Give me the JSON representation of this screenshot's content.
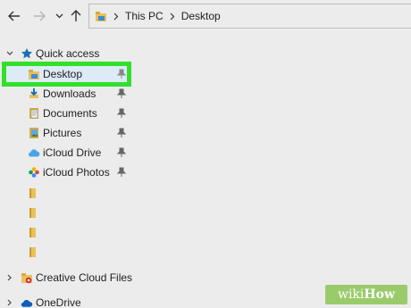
{
  "address": {
    "crumbs": [
      "This PC",
      "Desktop"
    ]
  },
  "nav": {
    "quick_access": "Quick access",
    "items": [
      {
        "label": "Desktop",
        "icon": "desktop-folder-icon",
        "pinned": true,
        "selected": true
      },
      {
        "label": "Downloads",
        "icon": "downloads-folder-icon",
        "pinned": true
      },
      {
        "label": "Documents",
        "icon": "documents-folder-icon",
        "pinned": true
      },
      {
        "label": "Pictures",
        "icon": "pictures-folder-icon",
        "pinned": true
      },
      {
        "label": "iCloud Drive",
        "icon": "icloud-drive-icon",
        "pinned": true
      },
      {
        "label": "iCloud Photos",
        "icon": "icloud-photos-icon",
        "pinned": true
      }
    ],
    "creative_cloud": "Creative Cloud Files",
    "onedrive": "OneDrive"
  },
  "colors": {
    "highlight_border": "#32e02b",
    "selection_bg": "#ddebf7",
    "folder": "#e8c15a",
    "accent_blue": "#1f6fb5"
  },
  "watermark": {
    "wiki": "wiki",
    "how": "How"
  }
}
